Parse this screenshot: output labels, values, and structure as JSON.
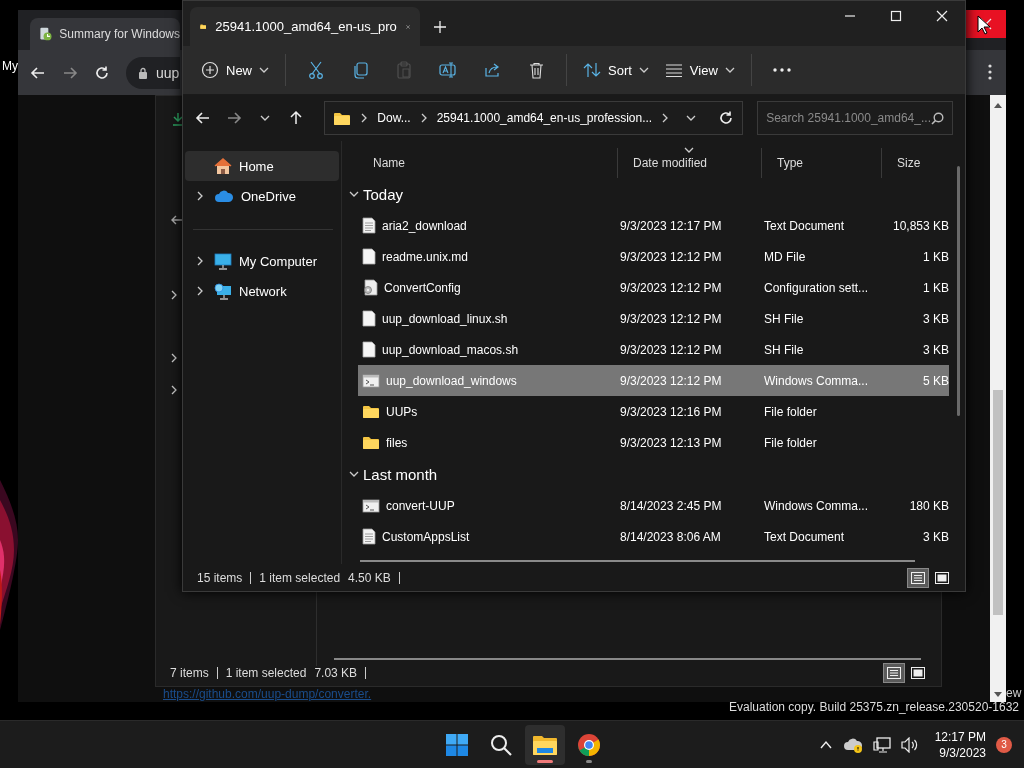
{
  "desktop": {
    "icon_label": "My",
    "edge_text": "ew",
    "watermark": "Evaluation copy. Build 25375.zn_release.230520-1632"
  },
  "browser": {
    "tab_title": "Summary for Windows",
    "address": "uup",
    "close_hovered": true,
    "page_link": "https://github.com/uup-dump/converter.",
    "inner_explorer": {
      "status": {
        "count": "7 items",
        "selection": "1 item selected",
        "size": "7.03 KB"
      },
      "view_buttons": [
        {
          "kind": "details",
          "selected": true
        },
        {
          "kind": "tiles",
          "selected": false
        }
      ]
    }
  },
  "explorer": {
    "tab_title": "25941.1000_amd64_en-us_pro",
    "toolbar": [
      [
        {
          "kind": "new",
          "label": "New"
        }
      ],
      [
        {
          "kind": "cut",
          "disabled": false
        },
        {
          "kind": "copy",
          "disabled": false
        },
        {
          "kind": "paste",
          "disabled": true
        },
        {
          "kind": "rename",
          "disabled": false
        },
        {
          "kind": "share",
          "disabled": false
        },
        {
          "kind": "delete",
          "disabled": false
        }
      ],
      [
        {
          "kind": "sort",
          "label": "Sort"
        },
        {
          "kind": "view",
          "label": "View"
        }
      ],
      [
        {
          "kind": "more"
        }
      ]
    ],
    "breadcrumb": [
      "Dow...",
      "25941.1000_amd64_en-us_profession..."
    ],
    "search": {
      "placeholder": "Search 25941.1000_amd64_..."
    },
    "nav": [
      {
        "label": "Home",
        "kind": "home",
        "selected": true,
        "expandable": false
      },
      {
        "label": "OneDrive",
        "kind": "cloud",
        "selected": false,
        "expandable": true
      },
      {
        "label": "My Computer",
        "kind": "computer",
        "selected": false,
        "expandable": true
      },
      {
        "label": "Network",
        "kind": "network",
        "selected": false,
        "expandable": true
      }
    ],
    "columns": [
      {
        "label": "Name",
        "sorted": false
      },
      {
        "label": "Date modified",
        "sorted": true
      },
      {
        "label": "Type",
        "sorted": false
      },
      {
        "label": "Size",
        "sorted": false
      }
    ],
    "groups": [
      {
        "label": "Today",
        "expanded": true,
        "rows": [
          {
            "kind": "text",
            "name": "aria2_download",
            "date": "9/3/2023 12:17 PM",
            "type": "Text Document",
            "size": "10,853 KB",
            "selected": false
          },
          {
            "kind": "blank",
            "name": "readme.unix.md",
            "date": "9/3/2023 12:12 PM",
            "type": "MD File",
            "size": "1 KB",
            "selected": false
          },
          {
            "kind": "config",
            "name": "ConvertConfig",
            "date": "9/3/2023 12:12 PM",
            "type": "Configuration sett...",
            "size": "1 KB",
            "selected": false
          },
          {
            "kind": "blank",
            "name": "uup_download_linux.sh",
            "date": "9/3/2023 12:12 PM",
            "type": "SH File",
            "size": "3 KB",
            "selected": false
          },
          {
            "kind": "blank",
            "name": "uup_download_macos.sh",
            "date": "9/3/2023 12:12 PM",
            "type": "SH File",
            "size": "3 KB",
            "selected": false
          },
          {
            "kind": "cmd",
            "name": "uup_download_windows",
            "date": "9/3/2023 12:12 PM",
            "type": "Windows Comma...",
            "size": "5 KB",
            "selected": true
          },
          {
            "kind": "folder",
            "name": "UUPs",
            "date": "9/3/2023 12:16 PM",
            "type": "File folder",
            "selected": false
          },
          {
            "kind": "folder",
            "name": "files",
            "date": "9/3/2023 12:13 PM",
            "type": "File folder",
            "selected": false
          }
        ]
      },
      {
        "label": "Last month",
        "expanded": true,
        "rows": [
          {
            "kind": "cmd",
            "name": "convert-UUP",
            "date": "8/14/2023 2:45 PM",
            "type": "Windows Comma...",
            "size": "180 KB",
            "selected": false
          },
          {
            "kind": "text",
            "name": "CustomAppsList",
            "date": "8/14/2023 8:06 AM",
            "type": "Text Document",
            "size": "3 KB",
            "selected": false
          }
        ]
      }
    ],
    "status": {
      "count": "15 items",
      "selection": "1 item selected",
      "size": "4.50 KB"
    },
    "view_buttons": [
      {
        "kind": "details",
        "selected": true
      },
      {
        "kind": "tiles",
        "selected": false
      }
    ]
  },
  "taskbar": {
    "apps": [
      {
        "kind": "start",
        "active": false
      },
      {
        "kind": "search",
        "active": false
      },
      {
        "kind": "explorer",
        "active": true
      },
      {
        "kind": "chrome",
        "active": false
      }
    ],
    "clock": {
      "time": "12:17 PM",
      "date": "9/3/2023"
    },
    "notifications": "3"
  }
}
